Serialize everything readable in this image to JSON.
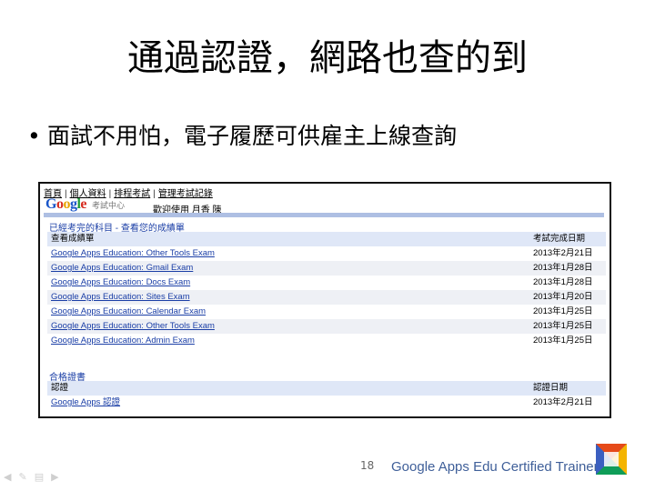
{
  "slide": {
    "title": "通過認證，網路也查的到",
    "bullet": "面試不用怕，電子履歷可供雇主上線查詢",
    "page_number": "18",
    "footer_brand": "Google Apps Edu Certified Trainer"
  },
  "portal": {
    "nav": [
      "首頁",
      "個人資料",
      "排程考試",
      "管理考試記錄"
    ],
    "logo_text": "Google",
    "logo_sub": "考試中心",
    "welcome": "歡迎使用 月香 陳",
    "completed_section_title": "已經考完的科目 - 查看您的成績單",
    "completed_headers": [
      "查看成績單",
      "考試完成日期"
    ],
    "exams": [
      {
        "name": "Google Apps Education: Other Tools Exam",
        "date": "2013年2月21日"
      },
      {
        "name": "Google Apps Education: Gmail Exam",
        "date": "2013年1月28日"
      },
      {
        "name": "Google Apps Education: Docs Exam",
        "date": "2013年1月28日"
      },
      {
        "name": "Google Apps Education: Sites Exam",
        "date": "2013年1月20日"
      },
      {
        "name": "Google Apps Education: Calendar Exam",
        "date": "2013年1月25日"
      },
      {
        "name": "Google Apps Education: Other Tools Exam",
        "date": "2013年1月25日"
      },
      {
        "name": "Google Apps Education: Admin Exam",
        "date": "2013年1月25日"
      }
    ],
    "cert_section_title": "合格證書",
    "cert_headers": [
      "認證",
      "認證日期"
    ],
    "certs": [
      {
        "name": "Google Apps 認證",
        "date": "2013年2月21日"
      }
    ]
  },
  "colors": {
    "link_blue": "#1a3ea6",
    "footer_text": "#3f5f99"
  }
}
